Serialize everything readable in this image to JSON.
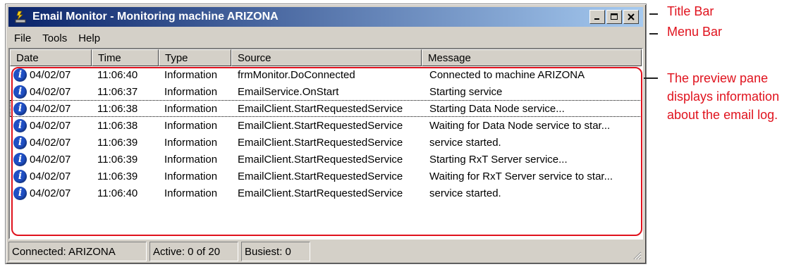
{
  "window": {
    "title": "Email Monitor - Monitoring machine ARIZONA",
    "controls": {
      "minimize": "_",
      "maximize": "□",
      "close": "×"
    }
  },
  "menu": [
    "File",
    "Tools",
    "Help"
  ],
  "columns": [
    "Date",
    "Time",
    "Type",
    "Source",
    "Message"
  ],
  "rows": [
    {
      "icon": "info-icon",
      "date": "04/02/07",
      "time": "11:06:40",
      "type": "Information",
      "source": "frmMonitor.DoConnected",
      "message": "Connected to machine ARIZONA"
    },
    {
      "icon": "info-icon",
      "date": "04/02/07",
      "time": "11:06:37",
      "type": "Information",
      "source": "EmailService.OnStart",
      "message": "Starting service"
    },
    {
      "icon": "info-icon",
      "date": "04/02/07",
      "time": "11:06:38",
      "type": "Information",
      "source": "EmailClient.StartRequestedService",
      "message": "Starting Data Node service..."
    },
    {
      "icon": "info-icon",
      "date": "04/02/07",
      "time": "11:06:38",
      "type": "Information",
      "source": "EmailClient.StartRequestedService",
      "message": "Waiting for Data Node service to star..."
    },
    {
      "icon": "info-icon",
      "date": "04/02/07",
      "time": "11:06:39",
      "type": "Information",
      "source": "EmailClient.StartRequestedService",
      "message": " service started."
    },
    {
      "icon": "info-icon",
      "date": "04/02/07",
      "time": "11:06:39",
      "type": "Information",
      "source": "EmailClient.StartRequestedService",
      "message": "Starting RxT Server service..."
    },
    {
      "icon": "info-icon",
      "date": "04/02/07",
      "time": "11:06:39",
      "type": "Information",
      "source": "EmailClient.StartRequestedService",
      "message": "Waiting for RxT Server service to star..."
    },
    {
      "icon": "info-icon",
      "date": "04/02/07",
      "time": "11:06:40",
      "type": "Information",
      "source": "EmailClient.StartRequestedService",
      "message": " service started."
    }
  ],
  "selected_row": 2,
  "status": {
    "connection": "Connected: ARIZONA",
    "active": "Active: 0 of 20",
    "busiest": "Busiest: 0"
  },
  "annotations": {
    "title_bar": "Title Bar",
    "menu_bar": "Menu Bar",
    "preview_pane": [
      "The preview pane",
      "displays information",
      "about the email log."
    ]
  },
  "colors": {
    "annotation": "#e0121d",
    "title_start": "#0a246a",
    "title_end": "#a6caf0"
  }
}
